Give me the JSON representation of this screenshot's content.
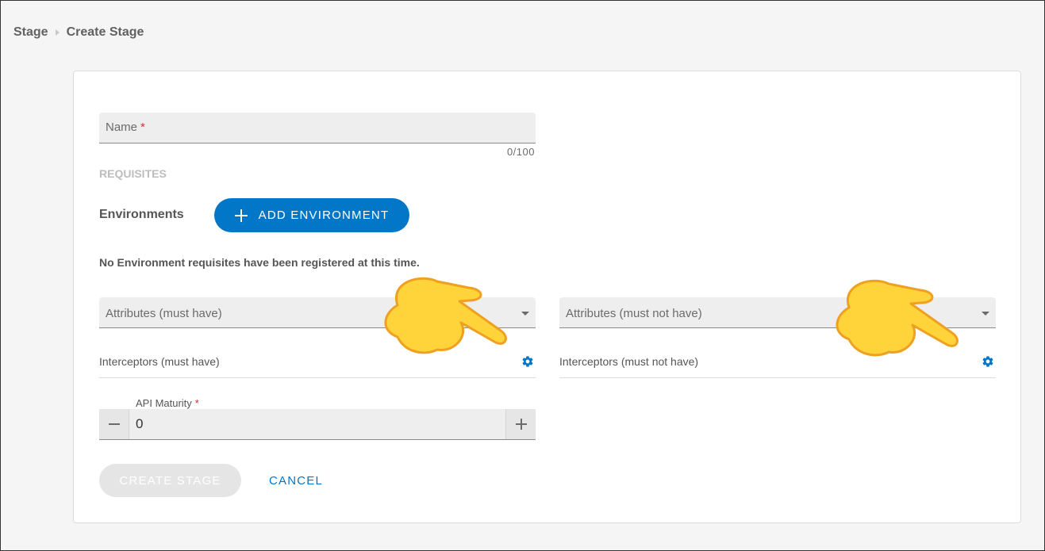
{
  "breadcrumb": {
    "items": [
      "Stage",
      "Create Stage"
    ]
  },
  "form": {
    "name": {
      "label": "Name",
      "required_mark": "*",
      "counter": "0/100"
    },
    "requisites_title": "REQUISITES",
    "environments": {
      "label": "Environments",
      "add_button": "ADD ENVIRONMENT",
      "empty_message": "No Environment requisites have been registered at this time."
    },
    "attributes_must_have": "Attributes (must have)",
    "attributes_must_not_have": "Attributes (must not have)",
    "interceptors_must_have": "Interceptors (must have)",
    "interceptors_must_not_have": "Interceptors (must not have)",
    "api_maturity": {
      "label": "API Maturity",
      "required_mark": "*",
      "value": "0"
    },
    "create_button": "CREATE STAGE",
    "cancel_button": "CANCEL"
  },
  "colors": {
    "primary": "#0277c7",
    "required": "#d32f2f",
    "disabled_button": "#e5e5e5",
    "pointer_hand": "#ffd43b"
  },
  "icons": {
    "gear": "gear-icon",
    "pointer": "pointing-hand-icon"
  }
}
